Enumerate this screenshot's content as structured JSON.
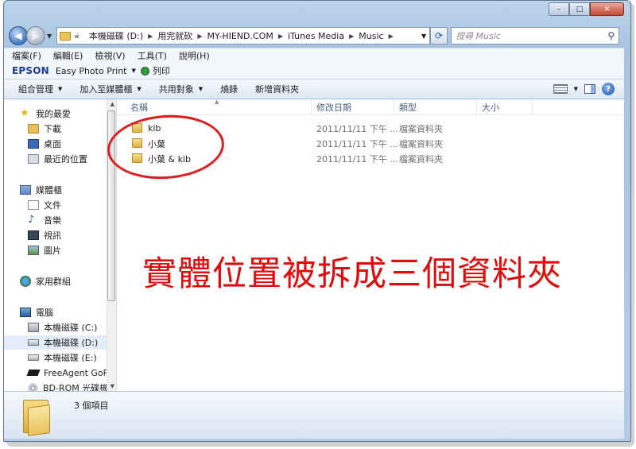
{
  "window": {
    "caption_buttons": {
      "minimize": "–",
      "maximize": "□",
      "close": "✕"
    }
  },
  "navigation": {
    "back_icon": "arrow-left-icon",
    "forward_icon": "arrow-right-icon",
    "breadcrumb_prefix": "«",
    "breadcrumb": [
      "本機磁碟 (D:)",
      "用完就砍",
      "MY-HIEND.COM",
      "iTunes Media",
      "Music"
    ],
    "search_placeholder": "搜尋 Music"
  },
  "menubar": [
    "檔案(F)",
    "編輯(E)",
    "檢視(V)",
    "工具(T)",
    "說明(H)"
  ],
  "epson_bar": {
    "brand": "EPSON",
    "app": "Easy Photo Print",
    "print_label": "列印"
  },
  "command_bar": {
    "organize": "組合管理",
    "include_in_library": "加入至媒體櫃",
    "share_with": "共用對象",
    "burn": "燒錄",
    "new_folder": "新增資料夾"
  },
  "nav_pane": {
    "favorites": {
      "label": "我的最愛",
      "items": [
        "下載",
        "桌面",
        "最近的位置"
      ]
    },
    "libraries": {
      "label": "媒體櫃",
      "items": [
        "文件",
        "音樂",
        "視訊",
        "圖片"
      ]
    },
    "homegroup": "家用群組",
    "computer": {
      "label": "電腦",
      "items": [
        "本機磁碟 (C:)",
        "本機磁碟 (D:)",
        "本機磁碟 (E:)",
        "FreeAgent GoFle",
        "BD-ROM 光碟機"
      ]
    }
  },
  "columns": {
    "name": "名稱",
    "modified": "修改日期",
    "type": "類型",
    "size": "大小"
  },
  "files": [
    {
      "name": "kib",
      "modified": "2011/11/11 下午 ...",
      "type": "檔案資料夾",
      "size": ""
    },
    {
      "name": "小葉",
      "modified": "2011/11/11 下午 ...",
      "type": "檔案資料夾",
      "size": ""
    },
    {
      "name": "小葉 & kib",
      "modified": "2011/11/11 下午 ...",
      "type": "檔案資料夾",
      "size": ""
    }
  ],
  "annotation": {
    "text": "實體位置被拆成三個資料夾",
    "color": "#e00d0d"
  },
  "details_pane": {
    "item_count": "3 個項目"
  },
  "colors": {
    "accent": "#3f78bd",
    "annotation_red": "#e01b1b"
  }
}
